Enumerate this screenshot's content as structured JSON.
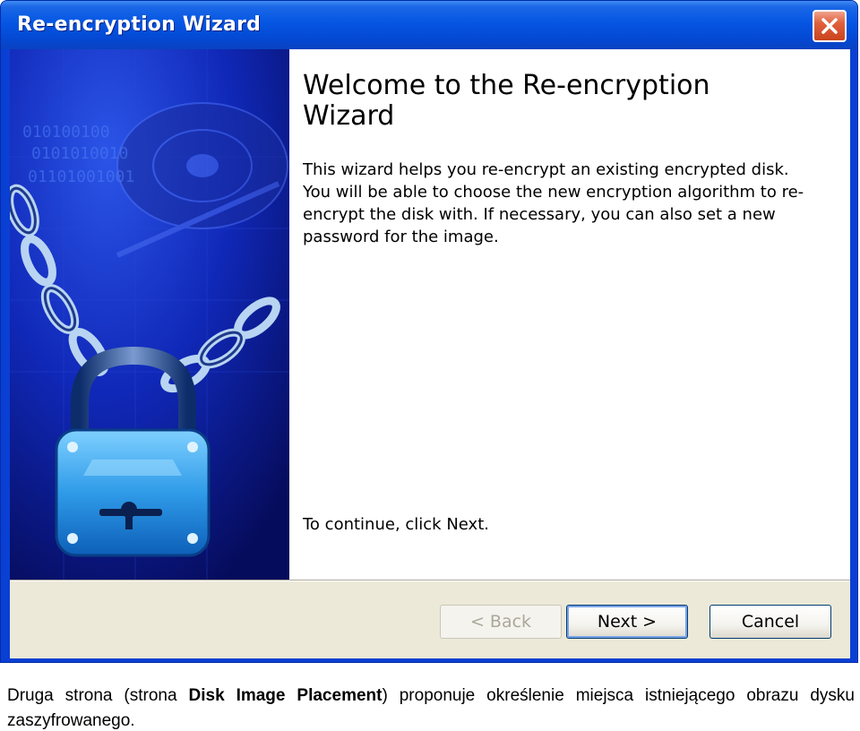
{
  "window": {
    "title": "Re-encryption Wizard"
  },
  "welcome": {
    "heading": "Welcome to the Re-encryption Wizard",
    "body": "This wizard helps you re-encrypt an existing encrypted disk. You will be able to choose the new encryption algorithm to re-encrypt the disk with. If necessary, you can also set a new password for the image.",
    "continue": "To continue, click Next."
  },
  "art": {
    "binary_lines": [
      "010100100",
      "0101010010",
      "01101001001"
    ]
  },
  "buttons": {
    "back": "< Back",
    "next": "Next >",
    "cancel": "Cancel",
    "back_enabled": false
  },
  "caption": {
    "part1": "Druga strona (strona ",
    "bold": "Disk Image Placement",
    "part2": ") proponuje określenie miejsca istniejącego obrazu dysku zaszyfrowanego."
  },
  "colors": {
    "titlebar": "#0556e3",
    "client": "#ece9d8",
    "close_button": "#e1603c",
    "art_background": "#0a1784"
  },
  "icons": {
    "close": "close-icon",
    "art": "padlock-chain-illustration"
  }
}
